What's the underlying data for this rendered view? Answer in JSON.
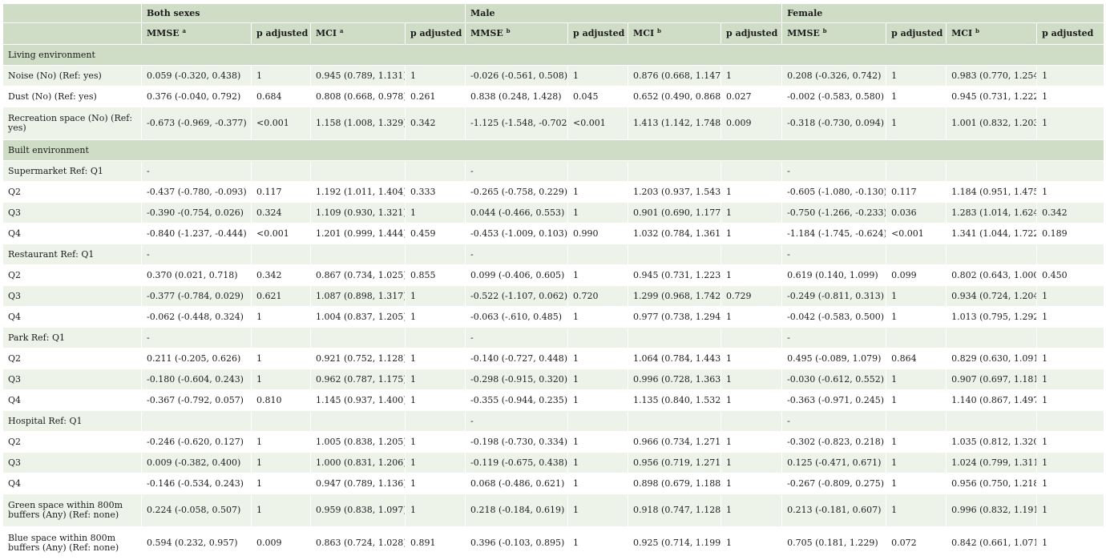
{
  "header": {
    "groups": [
      "",
      "Both sexes",
      "Male",
      "Female"
    ],
    "columns": [
      {
        "label": "",
        "sup": ""
      },
      {
        "label": "MMSE",
        "sup": "a"
      },
      {
        "label": "p adjusted",
        "sup": ""
      },
      {
        "label": "MCI",
        "sup": "a"
      },
      {
        "label": "p adjusted",
        "sup": ""
      },
      {
        "label": "MMSE",
        "sup": "b"
      },
      {
        "label": "p adjusted",
        "sup": ""
      },
      {
        "label": "MCI",
        "sup": "b"
      },
      {
        "label": "p adjusted",
        "sup": ""
      },
      {
        "label": "MMSE",
        "sup": "b"
      },
      {
        "label": "p adjusted",
        "sup": ""
      },
      {
        "label": "MCI",
        "sup": "b"
      },
      {
        "label": "p adjusted",
        "sup": ""
      }
    ]
  },
  "rows": [
    {
      "type": "section",
      "label": "Living environment"
    },
    {
      "type": "data",
      "cells": [
        "Noise (No) (Ref: yes)",
        "0.059 (-0.320, 0.438)",
        "1",
        "0.945 (0.789, 1.131)",
        "1",
        "-0.026 (-0.561, 0.508)",
        "1",
        "0.876 (0.668, 1.147)",
        "1",
        "0.208 (-0.326, 0.742)",
        "1",
        "0.983 (0.770, 1.254)",
        "1"
      ]
    },
    {
      "type": "data",
      "cells": [
        "Dust (No) (Ref: yes)",
        "0.376 (-0.040, 0.792)",
        "0.684",
        "0.808 (0.668, 0.978)",
        "0.261",
        "0.838 (0.248, 1.428)",
        "0.045",
        "0.652 (0.490, 0.868)",
        "0.027",
        "-0.002 (-0.583, 0.580)",
        "1",
        "0.945 (0.731, 1.222)",
        "1"
      ]
    },
    {
      "type": "data",
      "tall": true,
      "cells": [
        "Recreation space (No) (Ref: yes)",
        "-0.673 (-0.969, -0.377)",
        "<0.001",
        "1.158 (1.008, 1.329)",
        "0.342",
        "-1.125 (-1.548, -0.702)",
        "<0.001",
        "1.413 (1.142, 1.748)",
        "0.009",
        "-0.318 (-0.730, 0.094)",
        "1",
        "1.001 (0.832, 1.203)",
        "1"
      ]
    },
    {
      "type": "section",
      "label": "Built environment"
    },
    {
      "type": "data",
      "cells": [
        "Supermarket Ref: Q1",
        "-",
        "",
        "",
        "",
        "-",
        "",
        "",
        "",
        "-",
        "",
        "",
        ""
      ]
    },
    {
      "type": "data",
      "cells": [
        "Q2",
        "-0.437 (-0.780, -0.093)",
        "0.117",
        "1.192 (1.011, 1.404)",
        "0.333",
        "-0.265 (-0.758, 0.229)",
        "1",
        "1.203 (0.937, 1.543)",
        "1",
        "-0.605 (-1.080, -0.130)",
        "0.117",
        "1.184 (0.951, 1.475)",
        "1"
      ]
    },
    {
      "type": "data",
      "cells": [
        "Q3",
        "-0.390 -(0.754, 0.026)",
        "0.324",
        "1.109 (0.930, 1.321)",
        "1",
        "0.044 (-0.466, 0.553)",
        "1",
        "0.901 (0.690, 1.177)",
        "1",
        "-0.750 (-1.266, -0.233)",
        "0.036",
        "1.283 (1.014, 1.624)",
        "0.342"
      ]
    },
    {
      "type": "data",
      "cells": [
        "Q4",
        "-0.840 (-1.237, -0.444)",
        "<0.001",
        "1.201 (0.999, 1.444)",
        "0.459",
        "-0.453 (-1.009, 0.103)",
        "0.990",
        "1.032 (0.784, 1.361)",
        "1",
        "-1.184 (-1.745, -0.624)",
        "<0.001",
        "1.341 (1.044, 1.722)",
        "0.189"
      ]
    },
    {
      "type": "data",
      "cells": [
        "Restaurant Ref: Q1",
        "-",
        "",
        "",
        "",
        "-",
        "",
        "",
        "",
        "-",
        "",
        "",
        ""
      ]
    },
    {
      "type": "data",
      "cells": [
        "Q2",
        "0.370 (0.021, 0.718)",
        "0.342",
        "0.867 (0.734, 1.025)",
        "0.855",
        "0.099 (-0.406, 0.605)",
        "1",
        "0.945 (0.731, 1.223)",
        "1",
        "0.619 (0.140, 1.099)",
        "0.099",
        "0.802 (0.643, 1.000)",
        "0.450"
      ]
    },
    {
      "type": "data",
      "cells": [
        "Q3",
        "-0.377 (-0.784, 0.029)",
        "0.621",
        "1.087 (0.898, 1.317)",
        "1",
        "-0.522 (-1.107, 0.062)",
        "0.720",
        "1.299 (0.968, 1.742)",
        "0.729",
        "-0.249 (-0.811, 0.313)",
        "1",
        "0.934 (0.724, 1.204)",
        "1"
      ]
    },
    {
      "type": "data",
      "cells": [
        "Q4",
        "-0.062  (-0.448, 0.324)",
        "1",
        "1.004 (0.837, 1.205)",
        "1",
        "-0.063 (-.610, 0.485)",
        "1",
        "0.977 (0.738, 1.294)",
        "1",
        "-0.042 (-0.583, 0.500)",
        "1",
        "1.013 (0.795, 1.292)",
        "1"
      ]
    },
    {
      "type": "data",
      "cells": [
        "Park  Ref: Q1",
        "-",
        "",
        "",
        "",
        "-",
        "",
        "",
        "",
        "-",
        "",
        "",
        ""
      ]
    },
    {
      "type": "data",
      "cells": [
        "Q2",
        "0.211 (-0.205, 0.626)",
        "1",
        "0.921 (0.752, 1.128)",
        "1",
        "-0.140 (-0.727, 0.448)",
        "1",
        "1.064 (0.784, 1.443)",
        "1",
        "0.495 (-0.089, 1.079)",
        "0.864",
        "0.829 (0.630, 1.091)",
        "1"
      ]
    },
    {
      "type": "data",
      "cells": [
        "Q3",
        "-0.180 (-0.604, 0.243)",
        "1",
        "0.962 (0.787, 1.175)",
        "1",
        "-0.298 (-0.915, 0.320)",
        "1",
        "0.996 (0.728, 1.363)",
        "1",
        "-0.030 (-0.612, 0.552)",
        "1",
        "0.907 (0.697, 1.181)",
        "1"
      ]
    },
    {
      "type": "data",
      "cells": [
        "Q4",
        "-0.367 (-0.792, 0.057)",
        "0.810",
        "1.145 (0.937, 1.400)",
        "1",
        "-0.355 (-0.944, 0.235)",
        "1",
        "1.135 (0.840, 1.532)",
        "1",
        "-0.363 (-0.971, 0.245)",
        "1",
        "1.140 (0.867, 1.497)",
        "1"
      ]
    },
    {
      "type": "data",
      "cells": [
        "Hospital  Ref: Q1",
        "",
        "",
        "",
        "",
        "-",
        "",
        "",
        "",
        "-",
        "",
        "",
        ""
      ]
    },
    {
      "type": "data",
      "cells": [
        "Q2",
        "-0.246 (-0.620, 0.127)",
        "1",
        "1.005 (0.838, 1.205)",
        "1",
        "-0.198 (-0.730, 0.334)",
        "1",
        "0.966 (0.734, 1.271)",
        "1",
        "-0.302 (-0.823, 0.218)",
        "1",
        "1.035 (0.812, 1.320)",
        "1"
      ]
    },
    {
      "type": "data",
      "cells": [
        "Q3",
        "0.009 (-0.382, 0.400)",
        "1",
        "1.000 (0.831, 1.206)",
        "1",
        "-0.119 (-0.675, 0.438)",
        "1",
        "0.956 (0.719, 1.271)",
        "1",
        "0.125 (-0.471, 0.671)",
        "1",
        "1.024 (0.799, 1.311)",
        "1"
      ]
    },
    {
      "type": "data",
      "cells": [
        "Q4",
        "-0.146 (-0.534, 0.243)",
        "1",
        "0.947 (0.789, 1.136)",
        "1",
        "0.068 (-0.486, 0.621)",
        "1",
        "0.898 (0.679, 1.188)",
        "1",
        "-0.267 (-0.809, 0.275)",
        "1",
        "0.956 (0.750, 1.218)",
        "1"
      ]
    },
    {
      "type": "data",
      "tall": true,
      "cells": [
        "Green space within 800m buffers (Any) (Ref: none)",
        "0.224 (-0.058, 0.507)",
        "1",
        "0.959 (0.838, 1.097)",
        "1",
        "0.218 (-0.184, 0.619)",
        "1",
        "0.918 (0.747, 1.128)",
        "1",
        "0.213 (-0.181, 0.607)",
        "1",
        "0.996 (0.832, 1.191)",
        "1"
      ]
    },
    {
      "type": "data",
      "tall": true,
      "cells": [
        "Blue space within 800m buffers (Any) (Ref: none)",
        "0.594 (0.232, 0.957)",
        "0.009",
        "0.863 (0.724, 1.028)",
        "0.891",
        "0.396 (-0.103, 0.895)",
        "1",
        "0.925 (0.714, 1.199)",
        "1",
        "0.705 (0.181, 1.229)",
        "0.072",
        "0.842 (0.661, 1.071)",
        "1"
      ]
    }
  ]
}
